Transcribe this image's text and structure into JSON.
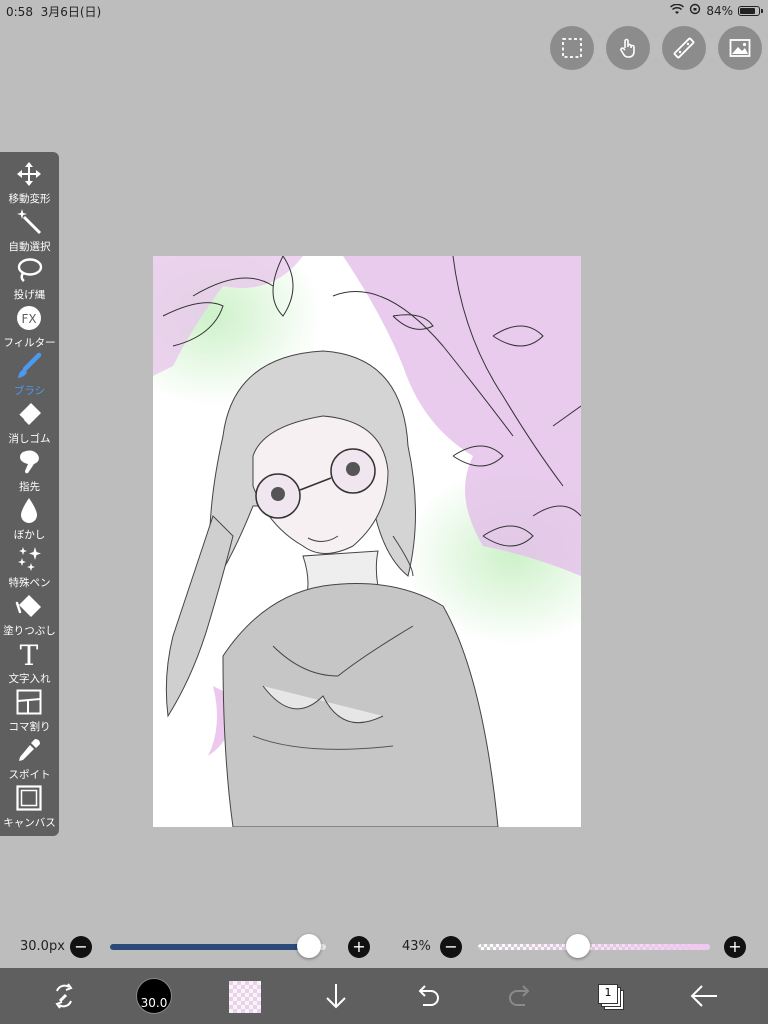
{
  "status": {
    "time": "0:58",
    "date": "3月6日(日)",
    "battery": "84%",
    "battery_fraction": 0.84
  },
  "top_actions": [
    {
      "name": "selection-icon"
    },
    {
      "name": "touch-icon"
    },
    {
      "name": "ruler-icon"
    },
    {
      "name": "image-icon"
    }
  ],
  "tools": [
    {
      "label": "移動変形",
      "icon": "move-icon"
    },
    {
      "label": "自動選択",
      "icon": "magic-wand-icon"
    },
    {
      "label": "投げ縄",
      "icon": "lasso-icon"
    },
    {
      "label": "フィルター",
      "icon": "fx-icon"
    },
    {
      "label": "ブラシ",
      "icon": "brush-icon"
    },
    {
      "label": "消しゴム",
      "icon": "eraser-icon"
    },
    {
      "label": "指先",
      "icon": "smudge-icon"
    },
    {
      "label": "ぼかし",
      "icon": "blur-icon"
    },
    {
      "label": "特殊ペン",
      "icon": "special-pen-icon"
    },
    {
      "label": "塗りつぶし",
      "icon": "fill-icon"
    },
    {
      "label": "文字入れ",
      "icon": "text-icon"
    },
    {
      "label": "コマ割り",
      "icon": "frame-divider-icon"
    },
    {
      "label": "スポイト",
      "icon": "eyedropper-icon"
    },
    {
      "label": "キャンバス",
      "icon": "canvas-icon"
    }
  ],
  "active_tool": "ブラシ",
  "fx_text": "FX",
  "text_tool_glyph": "T",
  "brush": {
    "size_label": "30.0px",
    "size_fraction": 0.92,
    "bottom_size_label": "30.0"
  },
  "opacity": {
    "label": "43%",
    "fraction": 0.43
  },
  "buttons": {
    "minus": "−",
    "plus": "+"
  },
  "colors": {
    "toolbar": "#5f5f5f",
    "background": "#bdbdbd",
    "active": "#4a9bf0",
    "size_track": "#2b4a78",
    "opacity_track": "#f0c8f0",
    "current_color": "#f4d7f4"
  },
  "layers_count": "1"
}
